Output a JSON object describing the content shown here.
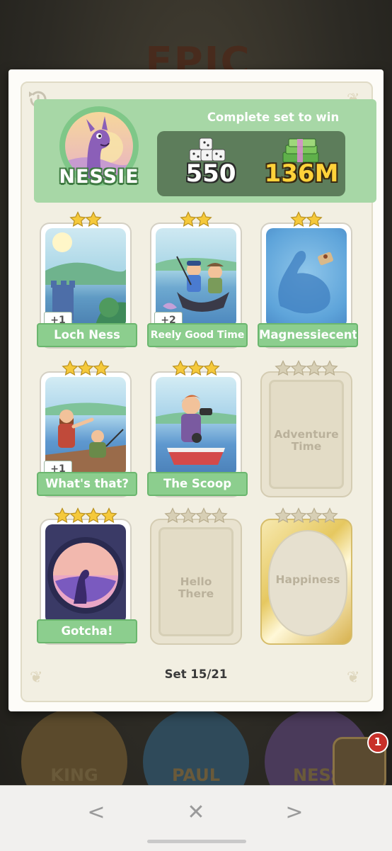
{
  "background": {
    "banner_text": "EPIC",
    "circle_labels": [
      "KING",
      "PAUL",
      "NESS"
    ],
    "notification_count": "1"
  },
  "header": {
    "character_name": "NESSIE",
    "reward_title": "Complete set to win",
    "dice_reward": "550",
    "cash_reward": "136M"
  },
  "cards": [
    {
      "title": "Loch Ness",
      "stars": 2,
      "collected": true,
      "extra": "+1"
    },
    {
      "title": "Reely Good Time",
      "stars": 2,
      "collected": true,
      "extra": "+2"
    },
    {
      "title": "Magnessiecent",
      "stars": 2,
      "collected": true,
      "extra": ""
    },
    {
      "title": "What's that?",
      "stars": 3,
      "collected": true,
      "extra": "+1"
    },
    {
      "title": "The Scoop",
      "stars": 3,
      "collected": true,
      "extra": ""
    },
    {
      "title": "Adventure Time",
      "stars": 4,
      "collected": false,
      "extra": ""
    },
    {
      "title": "Gotcha!",
      "stars": 4,
      "collected": true,
      "extra": ""
    },
    {
      "title": "Hello There",
      "stars": 4,
      "collected": false,
      "extra": ""
    },
    {
      "title": "Happiness",
      "stars": 4,
      "collected": false,
      "gold": true,
      "extra": ""
    }
  ],
  "set_label": "Set 15/21",
  "nav": {
    "back": "<",
    "close": "✕",
    "forward": ">"
  },
  "colors": {
    "accent_green": "#8cce8e",
    "star_gold": "#f5c93b",
    "star_empty": "#d7cfb5"
  }
}
